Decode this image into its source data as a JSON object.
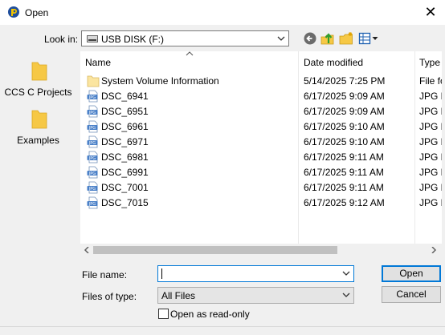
{
  "window": {
    "title": "Open",
    "close_glyph": "✕"
  },
  "toolbar": {
    "look_in_label": "Look in:",
    "look_in_value": "USB DISK (F:)",
    "icons": [
      "back-icon",
      "up-folder-icon",
      "new-folder-icon",
      "view-menu-icon"
    ]
  },
  "places": [
    {
      "label": "CCS C Projects"
    },
    {
      "label": "Examples"
    }
  ],
  "columns": {
    "name": "Name",
    "date": "Date modified",
    "type": "Type"
  },
  "files": [
    {
      "name": "System Volume Information",
      "date": "5/14/2025 7:25 PM",
      "type": "File fo",
      "icon": "folder"
    },
    {
      "name": "DSC_6941",
      "date": "6/17/2025 9:09 AM",
      "type": "JPG F",
      "icon": "jpg"
    },
    {
      "name": "DSC_6951",
      "date": "6/17/2025 9:09 AM",
      "type": "JPG F",
      "icon": "jpg"
    },
    {
      "name": "DSC_6961",
      "date": "6/17/2025 9:10 AM",
      "type": "JPG F",
      "icon": "jpg"
    },
    {
      "name": "DSC_6971",
      "date": "6/17/2025 9:10 AM",
      "type": "JPG F",
      "icon": "jpg"
    },
    {
      "name": "DSC_6981",
      "date": "6/17/2025 9:11 AM",
      "type": "JPG F",
      "icon": "jpg"
    },
    {
      "name": "DSC_6991",
      "date": "6/17/2025 9:11 AM",
      "type": "JPG F",
      "icon": "jpg"
    },
    {
      "name": "DSC_7001",
      "date": "6/17/2025 9:11 AM",
      "type": "JPG F",
      "icon": "jpg"
    },
    {
      "name": "DSC_7015",
      "date": "6/17/2025 9:12 AM",
      "type": "JPG F",
      "icon": "jpg"
    }
  ],
  "form": {
    "file_name_label": "File name:",
    "file_name_value": "",
    "files_of_type_label": "Files of type:",
    "files_of_type_value": "All Files",
    "read_only_label": "Open as read-only",
    "read_only_checked": false
  },
  "buttons": {
    "open": "Open",
    "cancel": "Cancel"
  },
  "colors": {
    "accent": "#0078d7",
    "folder": "#f6c845"
  }
}
